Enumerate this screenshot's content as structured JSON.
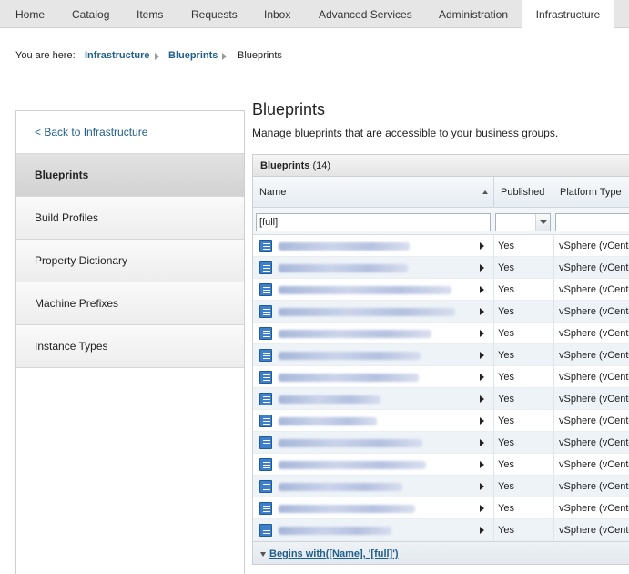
{
  "nav": {
    "tabs": [
      {
        "label": "Home"
      },
      {
        "label": "Catalog"
      },
      {
        "label": "Items"
      },
      {
        "label": "Requests"
      },
      {
        "label": "Inbox"
      },
      {
        "label": "Advanced Services"
      },
      {
        "label": "Administration"
      },
      {
        "label": "Infrastructure",
        "active": true
      }
    ]
  },
  "breadcrumb": {
    "prefix": "You are here:",
    "items": [
      "Infrastructure",
      "Blueprints",
      "Blueprints"
    ]
  },
  "sidebar": {
    "back_label": "< Back to Infrastructure",
    "items": [
      {
        "label": "Blueprints",
        "selected": true
      },
      {
        "label": "Build Profiles"
      },
      {
        "label": "Property Dictionary"
      },
      {
        "label": "Machine Prefixes"
      },
      {
        "label": "Instance Types"
      }
    ]
  },
  "page": {
    "title": "Blueprints",
    "subtitle": "Manage blueprints that are accessible to your business groups."
  },
  "grid": {
    "title": "Blueprints",
    "count": "(14)",
    "columns": [
      "Name",
      "Published",
      "Platform Type"
    ],
    "filter": {
      "name_value": "[full]",
      "published_value": "",
      "platform_value": ""
    },
    "rows": [
      {
        "name": "",
        "published": "Yes",
        "platform": "vSphere (vCenter)"
      },
      {
        "name": "",
        "published": "Yes",
        "platform": "vSphere (vCenter)"
      },
      {
        "name": "",
        "published": "Yes",
        "platform": "vSphere (vCenter)"
      },
      {
        "name": "",
        "published": "Yes",
        "platform": "vSphere (vCenter)"
      },
      {
        "name": "",
        "published": "Yes",
        "platform": "vSphere (vCenter)"
      },
      {
        "name": "",
        "published": "Yes",
        "platform": "vSphere (vCenter)"
      },
      {
        "name": "",
        "published": "Yes",
        "platform": "vSphere (vCenter)"
      },
      {
        "name": "",
        "published": "Yes",
        "platform": "vSphere (vCenter)"
      },
      {
        "name": "",
        "published": "Yes",
        "platform": "vSphere (vCenter)"
      },
      {
        "name": "",
        "published": "Yes",
        "platform": "vSphere (vCenter)"
      },
      {
        "name": "",
        "published": "Yes",
        "platform": "vSphere (vCenter)"
      },
      {
        "name": "",
        "published": "Yes",
        "platform": "vSphere (vCenter)"
      },
      {
        "name": "",
        "published": "Yes",
        "platform": "vSphere (vCenter)"
      },
      {
        "name": "",
        "published": "Yes",
        "platform": "vSphere (vCenter)"
      }
    ],
    "footer_filter": "Begins with([Name], '[full]')"
  }
}
